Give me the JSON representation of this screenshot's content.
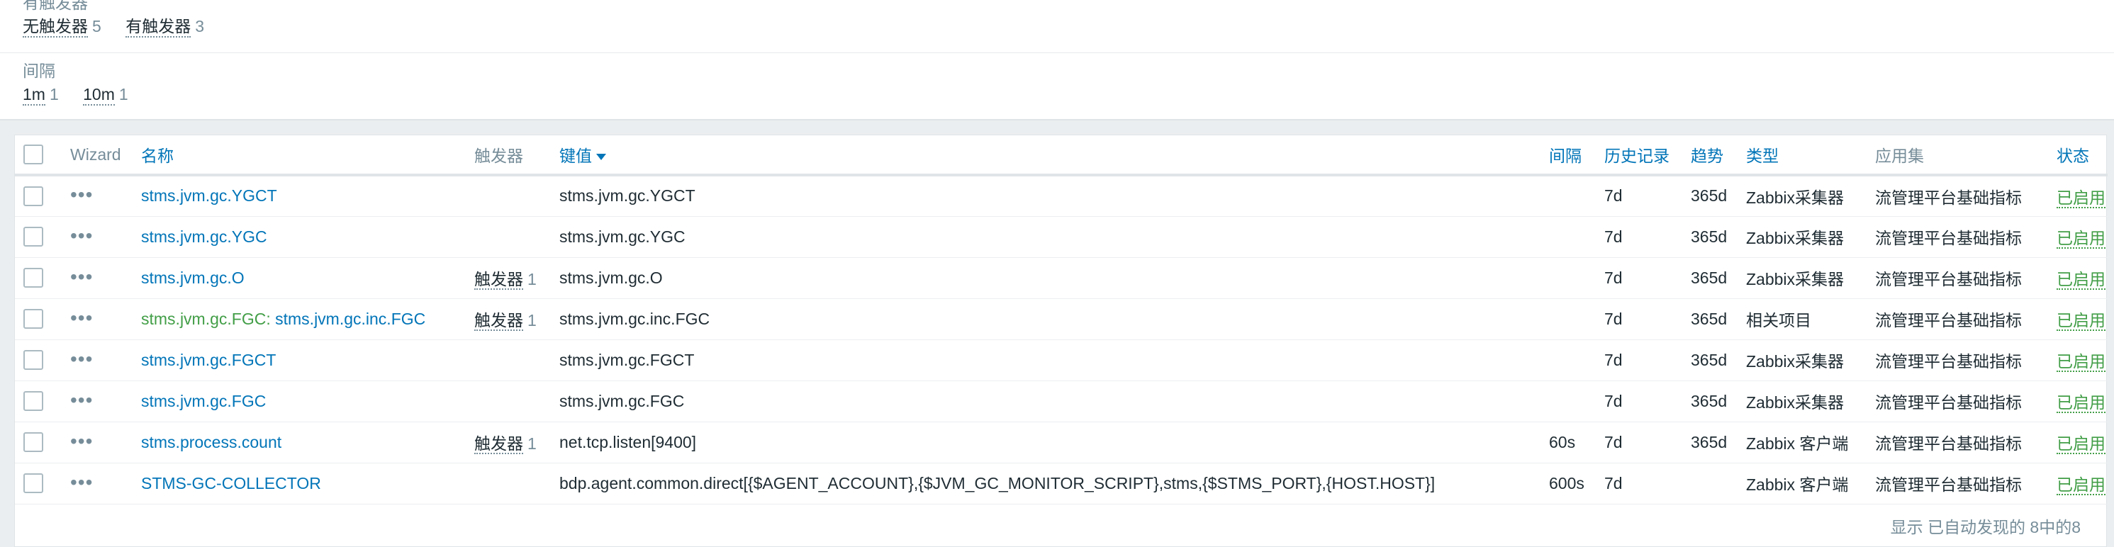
{
  "filters": {
    "triggers": {
      "title": "有触发器",
      "options": [
        {
          "label": "无触发器",
          "count": "5"
        },
        {
          "label": "有触发器",
          "count": "3"
        }
      ]
    },
    "interval": {
      "title": "间隔",
      "options": [
        {
          "label": "1m",
          "count": "1"
        },
        {
          "label": "10m",
          "count": "1"
        }
      ]
    }
  },
  "table": {
    "headers": {
      "wizard": "Wizard",
      "name": "名称",
      "triggers": "触发器",
      "key": "键值",
      "interval": "间隔",
      "history": "历史记录",
      "trends": "趋势",
      "type": "类型",
      "application": "应用集",
      "status": "状态"
    },
    "rows": [
      {
        "dots": "•••",
        "name_prefix": "",
        "name": "stms.jvm.gc.YGCT",
        "trigger_label": "",
        "trigger_count": "",
        "key": "stms.jvm.gc.YGCT",
        "interval": "",
        "history": "7d",
        "trends": "365d",
        "type": "Zabbix采集器",
        "application": "流管理平台基础指标",
        "status": "已启用"
      },
      {
        "dots": "•••",
        "name_prefix": "",
        "name": "stms.jvm.gc.YGC",
        "trigger_label": "",
        "trigger_count": "",
        "key": "stms.jvm.gc.YGC",
        "interval": "",
        "history": "7d",
        "trends": "365d",
        "type": "Zabbix采集器",
        "application": "流管理平台基础指标",
        "status": "已启用"
      },
      {
        "dots": "•••",
        "name_prefix": "",
        "name": "stms.jvm.gc.O",
        "trigger_label": "触发器",
        "trigger_count": "1",
        "key": "stms.jvm.gc.O",
        "interval": "",
        "history": "7d",
        "trends": "365d",
        "type": "Zabbix采集器",
        "application": "流管理平台基础指标",
        "status": "已启用"
      },
      {
        "dots": "•••",
        "name_prefix": "stms.jvm.gc.FGC:",
        "name": "stms.jvm.gc.inc.FGC",
        "trigger_label": "触发器",
        "trigger_count": "1",
        "key": "stms.jvm.gc.inc.FGC",
        "interval": "",
        "history": "7d",
        "trends": "365d",
        "type": "相关项目",
        "application": "流管理平台基础指标",
        "status": "已启用"
      },
      {
        "dots": "•••",
        "name_prefix": "",
        "name": "stms.jvm.gc.FGCT",
        "trigger_label": "",
        "trigger_count": "",
        "key": "stms.jvm.gc.FGCT",
        "interval": "",
        "history": "7d",
        "trends": "365d",
        "type": "Zabbix采集器",
        "application": "流管理平台基础指标",
        "status": "已启用"
      },
      {
        "dots": "•••",
        "name_prefix": "",
        "name": "stms.jvm.gc.FGC",
        "trigger_label": "",
        "trigger_count": "",
        "key": "stms.jvm.gc.FGC",
        "interval": "",
        "history": "7d",
        "trends": "365d",
        "type": "Zabbix采集器",
        "application": "流管理平台基础指标",
        "status": "已启用"
      },
      {
        "dots": "•••",
        "name_prefix": "",
        "name": "stms.process.count",
        "trigger_label": "触发器",
        "trigger_count": "1",
        "key": "net.tcp.listen[9400]",
        "interval": "60s",
        "history": "7d",
        "trends": "365d",
        "type": "Zabbix 客户端",
        "application": "流管理平台基础指标",
        "status": "已启用"
      },
      {
        "dots": "•••",
        "name_prefix": "",
        "name": "STMS-GC-COLLECTOR",
        "trigger_label": "",
        "trigger_count": "",
        "key": "bdp.agent.common.direct[{$AGENT_ACCOUNT},{$JVM_GC_MONITOR_SCRIPT},stms,{$STMS_PORT},{HOST.HOST}]",
        "interval": "600s",
        "history": "7d",
        "trends": "",
        "type": "Zabbix 客户端",
        "application": "流管理平台基础指标",
        "status": "已启用"
      }
    ],
    "footer": "显示 已自动发现的 8中的8"
  }
}
